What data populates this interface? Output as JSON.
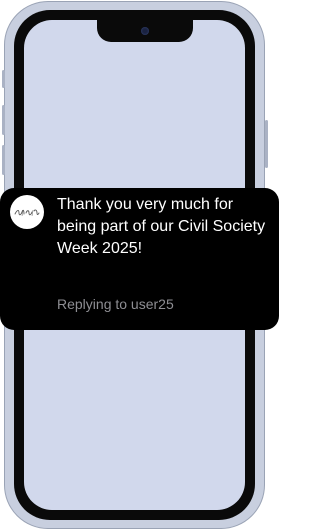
{
  "notification": {
    "message": "Thank you very much for being part of our Civil Society Week 2025!",
    "reply_label": "Replying to user25"
  },
  "avatar": {
    "icon": "signature-logo-icon"
  },
  "colors": {
    "screen": "#d1d8ec",
    "frame": "#c8cfdf",
    "banner": "#000000",
    "message_text": "#ffffff",
    "reply_text": "#8e8e93"
  }
}
